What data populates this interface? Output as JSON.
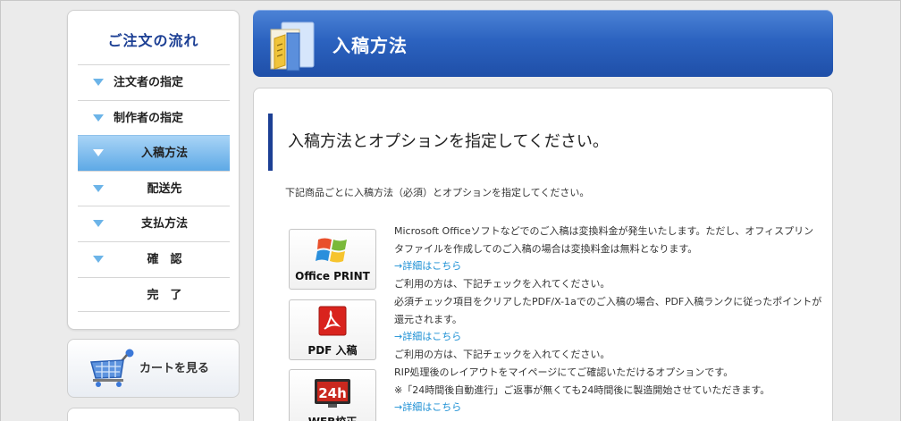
{
  "sidebar": {
    "title": "ご注文の流れ",
    "items": [
      {
        "label": "注文者の指定"
      },
      {
        "label": "制作者の指定"
      },
      {
        "label": "入稿方法"
      },
      {
        "label": "配送先"
      },
      {
        "label": "支払方法"
      },
      {
        "label": "確　認"
      },
      {
        "label": "完　了"
      }
    ],
    "active_index": 2,
    "cart_label": "カートを見る"
  },
  "header": {
    "title": "入稿方法",
    "icon": "folder-documents-icon"
  },
  "main": {
    "heading": "入稿方法とオプションを指定してください。",
    "intro": "下記商品ごとに入稿方法（必須）とオプションを指定してください。",
    "options": [
      {
        "label": "Office PRINT",
        "icon": "windows-logo-icon",
        "text": "Microsoft Officeソフトなどでのご入稿は変換料金が発生いたします。ただし、オフィスプリンタファイルを作成してのご入稿の場合は変換料金は無料となります。",
        "link": "→詳細はこちら",
        "note": "ご利用の方は、下記チェックを入れてください。"
      },
      {
        "label": "PDF 入稿",
        "icon": "acrobat-icon",
        "text": "必須チェック項目をクリアしたPDF/X-1aでのご入稿の場合、PDF入稿ランクに従ったポイントが還元されます。",
        "link": "→詳細はこちら",
        "note": "ご利用の方は、下記チェックを入れてください。"
      },
      {
        "label": "WEB校正",
        "icon": "monitor-24h-icon",
        "icon_text": "24h",
        "text": "RIP処理後のレイアウトをマイページにてご確認いただけるオプションです。",
        "text2": "※「24時間後自動進行」ご返事が無くても24時間後に製造開始させていただきます。",
        "link": "→詳細はこちら"
      }
    ]
  },
  "colors": {
    "header_blue": "#2c63c0",
    "nav_title": "#1c3f94",
    "link": "#1b8fd4",
    "active_item": "#5da9e6"
  }
}
